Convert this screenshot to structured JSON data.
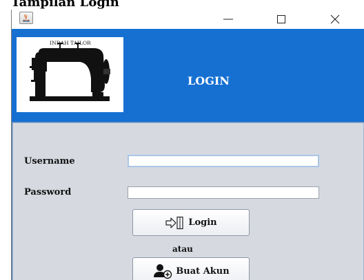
{
  "document": {
    "heading": "Tampilan Login"
  },
  "window": {
    "title": "",
    "icon": "java-app-icon",
    "controls": [
      "minimize-icon",
      "maximize-icon",
      "close-icon"
    ]
  },
  "header": {
    "logo_text": "INDAH TAILOR",
    "logo_icon": "sewing-machine-icon",
    "title": "LOGIN",
    "background_color": "#1670d2"
  },
  "form": {
    "username_label": "Username",
    "username_value": "",
    "password_label": "Password",
    "password_value": "",
    "login_button": "Login",
    "login_icon": "login-door-icon",
    "separator": "atau",
    "create_button": "Buat Akun",
    "create_icon": "add-user-icon",
    "panel_color": "#d6d9e0"
  }
}
